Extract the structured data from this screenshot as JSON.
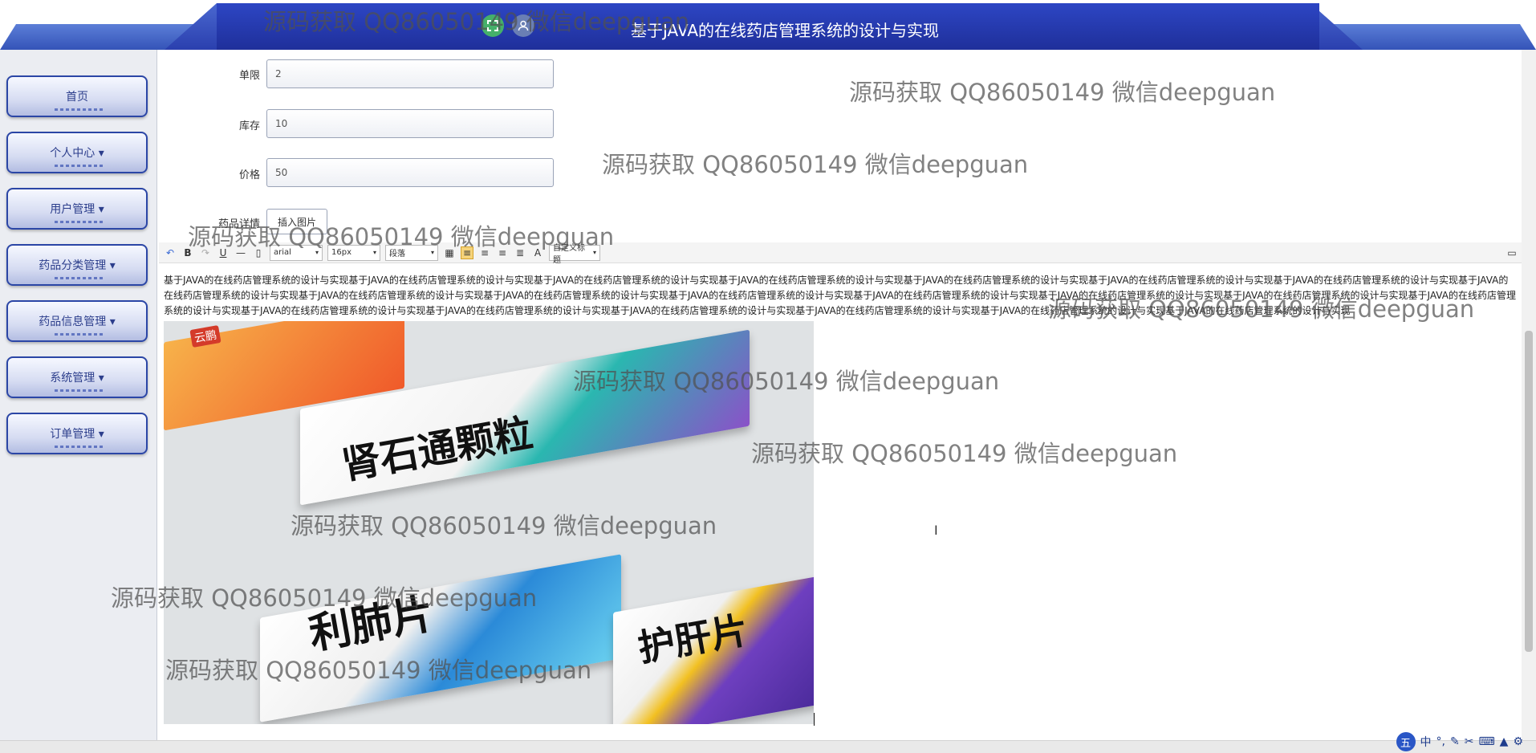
{
  "header": {
    "title": "基于JAVA的在线药店管理系统的设计与实现",
    "icons": [
      "fullscreen-icon",
      "user-icon"
    ]
  },
  "sidebar": {
    "items": [
      {
        "label": "首页"
      },
      {
        "label": "个人中心 ▾"
      },
      {
        "label": "用户管理 ▾"
      },
      {
        "label": "药品分类管理 ▾"
      },
      {
        "label": "药品信息管理 ▾"
      },
      {
        "label": "系统管理 ▾"
      },
      {
        "label": "订单管理 ▾"
      }
    ]
  },
  "form": {
    "limit": {
      "label": "单限",
      "value": "2"
    },
    "stock": {
      "label": "库存",
      "value": "10"
    },
    "price": {
      "label": "价格",
      "value": "50"
    },
    "detail_label": "药品详情",
    "insert_image_label": "插入图片"
  },
  "toolbar": {
    "font_family": "arial",
    "font_size": "16px",
    "paragraph": "段落",
    "custom_heading": "自定义标题",
    "buttons": [
      "undo-icon",
      "bold-icon",
      "redo-icon",
      "underline-icon",
      "hr-icon",
      "paste-icon",
      "table-icon",
      "align-left-icon",
      "align-center-icon",
      "align-right-icon",
      "justify-icon",
      "font-color-icon",
      "fullscreen-icon"
    ]
  },
  "editor": {
    "text": "基于JAVA的在线药店管理系统的设计与实现基于JAVA的在线药店管理系统的设计与实现基于JAVA的在线药店管理系统的设计与实现基于JAVA的在线药店管理系统的设计与实现基于JAVA的在线药店管理系统的设计与实现基于JAVA的在线药店管理系统的设计与实现基于JAVA的在线药店管理系统的设计与实现基于JAVA的在线药店管理系统的设计与实现基于JAVA的在线药店管理系统的设计与实现基于JAVA的在线药店管理系统的设计与实现基于JAVA的在线药店管理系统的设计与实现基于JAVA的在线药店管理系统的设计与实现基于JAVA的在线药店管理系统的设计与实现基于JAVA的在线药店管理系统的设计与实现基于JAVA的在线药店管理系统的设计与实现基于JAVA的在线药店管理系统的设计与实现基于JAVA的在线药店管理系统的设计与实现基于JAVA的在线药店管理系统的设计与实现基于JAVA的在线药店管理系统的设计与实现基于JAVA的在线药店管理系统的设计与实现基于JAVA的在线药店管理系统的设计与实现",
    "image_texts": [
      "肾石通颗粒",
      "利肺片",
      "护肝片",
      "云鹏"
    ]
  },
  "watermark": "源码获取 QQ86050149 微信deepguan",
  "ime": {
    "lang": "中"
  }
}
